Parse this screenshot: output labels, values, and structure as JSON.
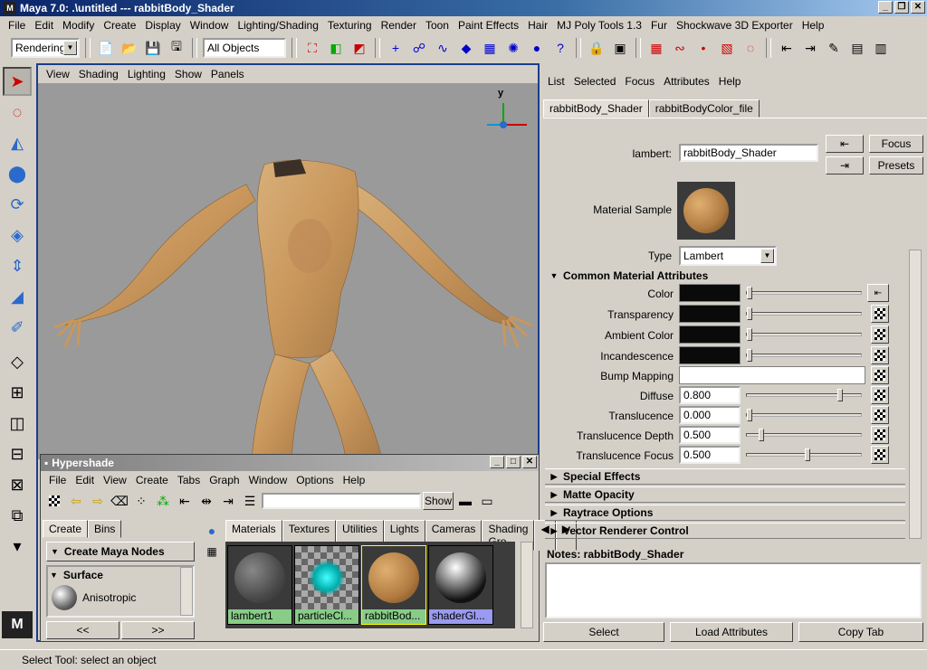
{
  "window": {
    "title": "Maya 7.0: .\\untitled   ---   rabbitBody_Shader",
    "app_icon": "M"
  },
  "menubar": [
    "File",
    "Edit",
    "Modify",
    "Create",
    "Display",
    "Window",
    "Lighting/Shading",
    "Texturing",
    "Render",
    "Toon",
    "Paint Effects",
    "Hair",
    "MJ Poly Tools 1.3",
    "Fur",
    "Shockwave 3D Exporter",
    "Help"
  ],
  "statusline": {
    "menuset": "Rendering",
    "selection_mask": "All Objects"
  },
  "viewport": {
    "menu": [
      "View",
      "Shading",
      "Lighting",
      "Show",
      "Panels"
    ],
    "axis_y": "y"
  },
  "hypershade": {
    "title": "Hypershade",
    "menu": [
      "File",
      "Edit",
      "View",
      "Create",
      "Tabs",
      "Graph",
      "Window",
      "Options",
      "Help"
    ],
    "show_label": "Show",
    "left_tabs": [
      "Create",
      "Bins"
    ],
    "create_nodes": "Create Maya Nodes",
    "node_category": "Surface",
    "node_item": "Anisotropic",
    "scroll_left": "<<",
    "scroll_right": ">>",
    "right_tabs": [
      "Materials",
      "Textures",
      "Utilities",
      "Lights",
      "Cameras",
      "Shading Gro"
    ],
    "swatches": [
      {
        "label": "lambert1",
        "color": "#88cc88"
      },
      {
        "label": "particleCl...",
        "color": "#88cc88"
      },
      {
        "label": "rabbitBod...",
        "color": "#88cc88"
      },
      {
        "label": "shaderGl...",
        "color": "#9a9af0"
      }
    ]
  },
  "attr_editor": {
    "menu": [
      "List",
      "Selected",
      "Focus",
      "Attributes",
      "Help"
    ],
    "tabs": [
      "rabbitBody_Shader",
      "rabbitBodyColor_file"
    ],
    "node_type_label": "lambert:",
    "node_name": "rabbitBody_Shader",
    "focus_btn": "Focus",
    "presets_btn": "Presets",
    "material_sample_label": "Material Sample",
    "type_label": "Type",
    "type_value": "Lambert",
    "section_common": "Common Material Attributes",
    "attributes": [
      {
        "label": "Color",
        "kind": "color",
        "slider": 0
      },
      {
        "label": "Transparency",
        "kind": "color",
        "slider": 0
      },
      {
        "label": "Ambient Color",
        "kind": "color",
        "slider": 0
      },
      {
        "label": "Incandescence",
        "kind": "color",
        "slider": 0
      },
      {
        "label": "Bump Mapping",
        "kind": "text",
        "value": ""
      },
      {
        "label": "Diffuse",
        "kind": "num",
        "value": "0.800",
        "slider": 0.8
      },
      {
        "label": "Translucence",
        "kind": "num",
        "value": "0.000",
        "slider": 0
      },
      {
        "label": "Translucence Depth",
        "kind": "num",
        "value": "0.500",
        "slider": 0.1
      },
      {
        "label": "Translucence Focus",
        "kind": "num",
        "value": "0.500",
        "slider": 0.5
      }
    ],
    "sections": [
      "Special Effects",
      "Matte Opacity",
      "Raytrace Options",
      "Vector Renderer Control"
    ],
    "notes_label": "Notes:  rabbitBody_Shader",
    "buttons": [
      "Select",
      "Load Attributes",
      "Copy Tab"
    ]
  },
  "statusbar": "Select Tool: select an object"
}
